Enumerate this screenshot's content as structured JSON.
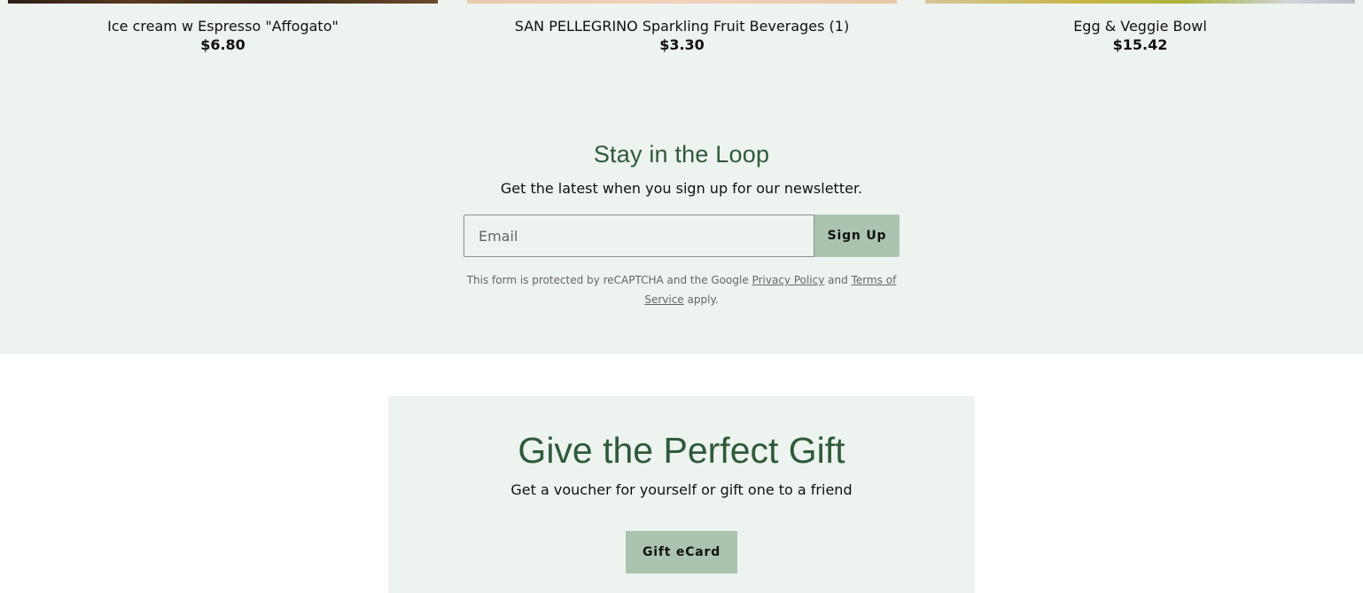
{
  "products": [
    {
      "name": "Ice cream w Espresso \"Affogato\"",
      "price": "$6.80"
    },
    {
      "name": "SAN PELLEGRINO Sparkling Fruit Beverages (1)",
      "price": "$3.30"
    },
    {
      "name": "Egg & Veggie Bowl",
      "price": "$15.42"
    }
  ],
  "newsletter": {
    "title": "Stay in the Loop",
    "subtitle": "Get the latest when you sign up for our newsletter.",
    "email_placeholder": "Email",
    "signup_label": "Sign Up",
    "legal_prefix": "This form is protected by reCAPTCHA and the Google",
    "privacy_link": "Privacy Policy",
    "legal_and": "and",
    "terms_link": "Terms of Service",
    "legal_suffix": "apply."
  },
  "gift": {
    "title": "Give the Perfect Gift",
    "subtitle": "Get a voucher for yourself or gift one to a friend",
    "button_label": "Gift eCard"
  },
  "colors": {
    "band_background": "#edf3ef",
    "heading_green": "#2f5a3a",
    "button_green": "#aac4b0"
  }
}
